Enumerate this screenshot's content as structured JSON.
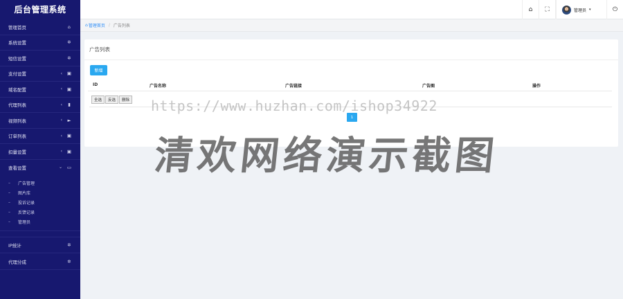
{
  "sidebar": {
    "brand": "后台管理系统",
    "items": [
      {
        "label": "管理首页",
        "icon": "⌂",
        "arrow": ""
      },
      {
        "label": "系统设置",
        "icon": "✲",
        "arrow": ""
      },
      {
        "label": "短信设置",
        "icon": "✲",
        "arrow": ""
      },
      {
        "label": "支付设置",
        "icon": "▣",
        "arrow": "‹"
      },
      {
        "label": "域名配置",
        "icon": "▣",
        "arrow": "‹"
      },
      {
        "label": "代理列表",
        "icon": "▮",
        "arrow": "‹"
      },
      {
        "label": "视频列表",
        "icon": "►",
        "arrow": "‹"
      },
      {
        "label": "订单列表",
        "icon": "▣",
        "arrow": "‹"
      },
      {
        "label": "扣量设置",
        "icon": "▣",
        "arrow": "‹"
      },
      {
        "label": "查看设置",
        "icon": "▭",
        "arrow": "⌄"
      }
    ],
    "submenu": [
      "广告管理",
      "图片库",
      "投诉记录",
      "反馈记录",
      "管理员"
    ],
    "bottom_items": [
      {
        "label": "IP统计",
        "icon": "✲"
      },
      {
        "label": "代理分成",
        "icon": "✲"
      }
    ]
  },
  "header": {
    "home_icon": "⌂",
    "fullscreen_icon": "⛶",
    "user_name": "管理员",
    "caret": "▾",
    "power_icon": "⏻"
  },
  "breadcrumb": {
    "home_icon": "⌂",
    "home": "管理首页",
    "separator": "/",
    "current": "广告列表"
  },
  "card": {
    "title": "广告列表",
    "add_button": "新增",
    "columns": [
      "ID",
      "广告名称",
      "广告链接",
      "广告图",
      "操作"
    ],
    "batch_buttons": [
      "全选",
      "反选",
      "删除"
    ],
    "page": "1"
  },
  "watermark": {
    "url": "https://www.huzhan.com/ishop34922",
    "text": "清欢网络演示截图"
  },
  "colors": {
    "sidebar_bg": "#17186f",
    "accent": "#2aa8f0"
  }
}
